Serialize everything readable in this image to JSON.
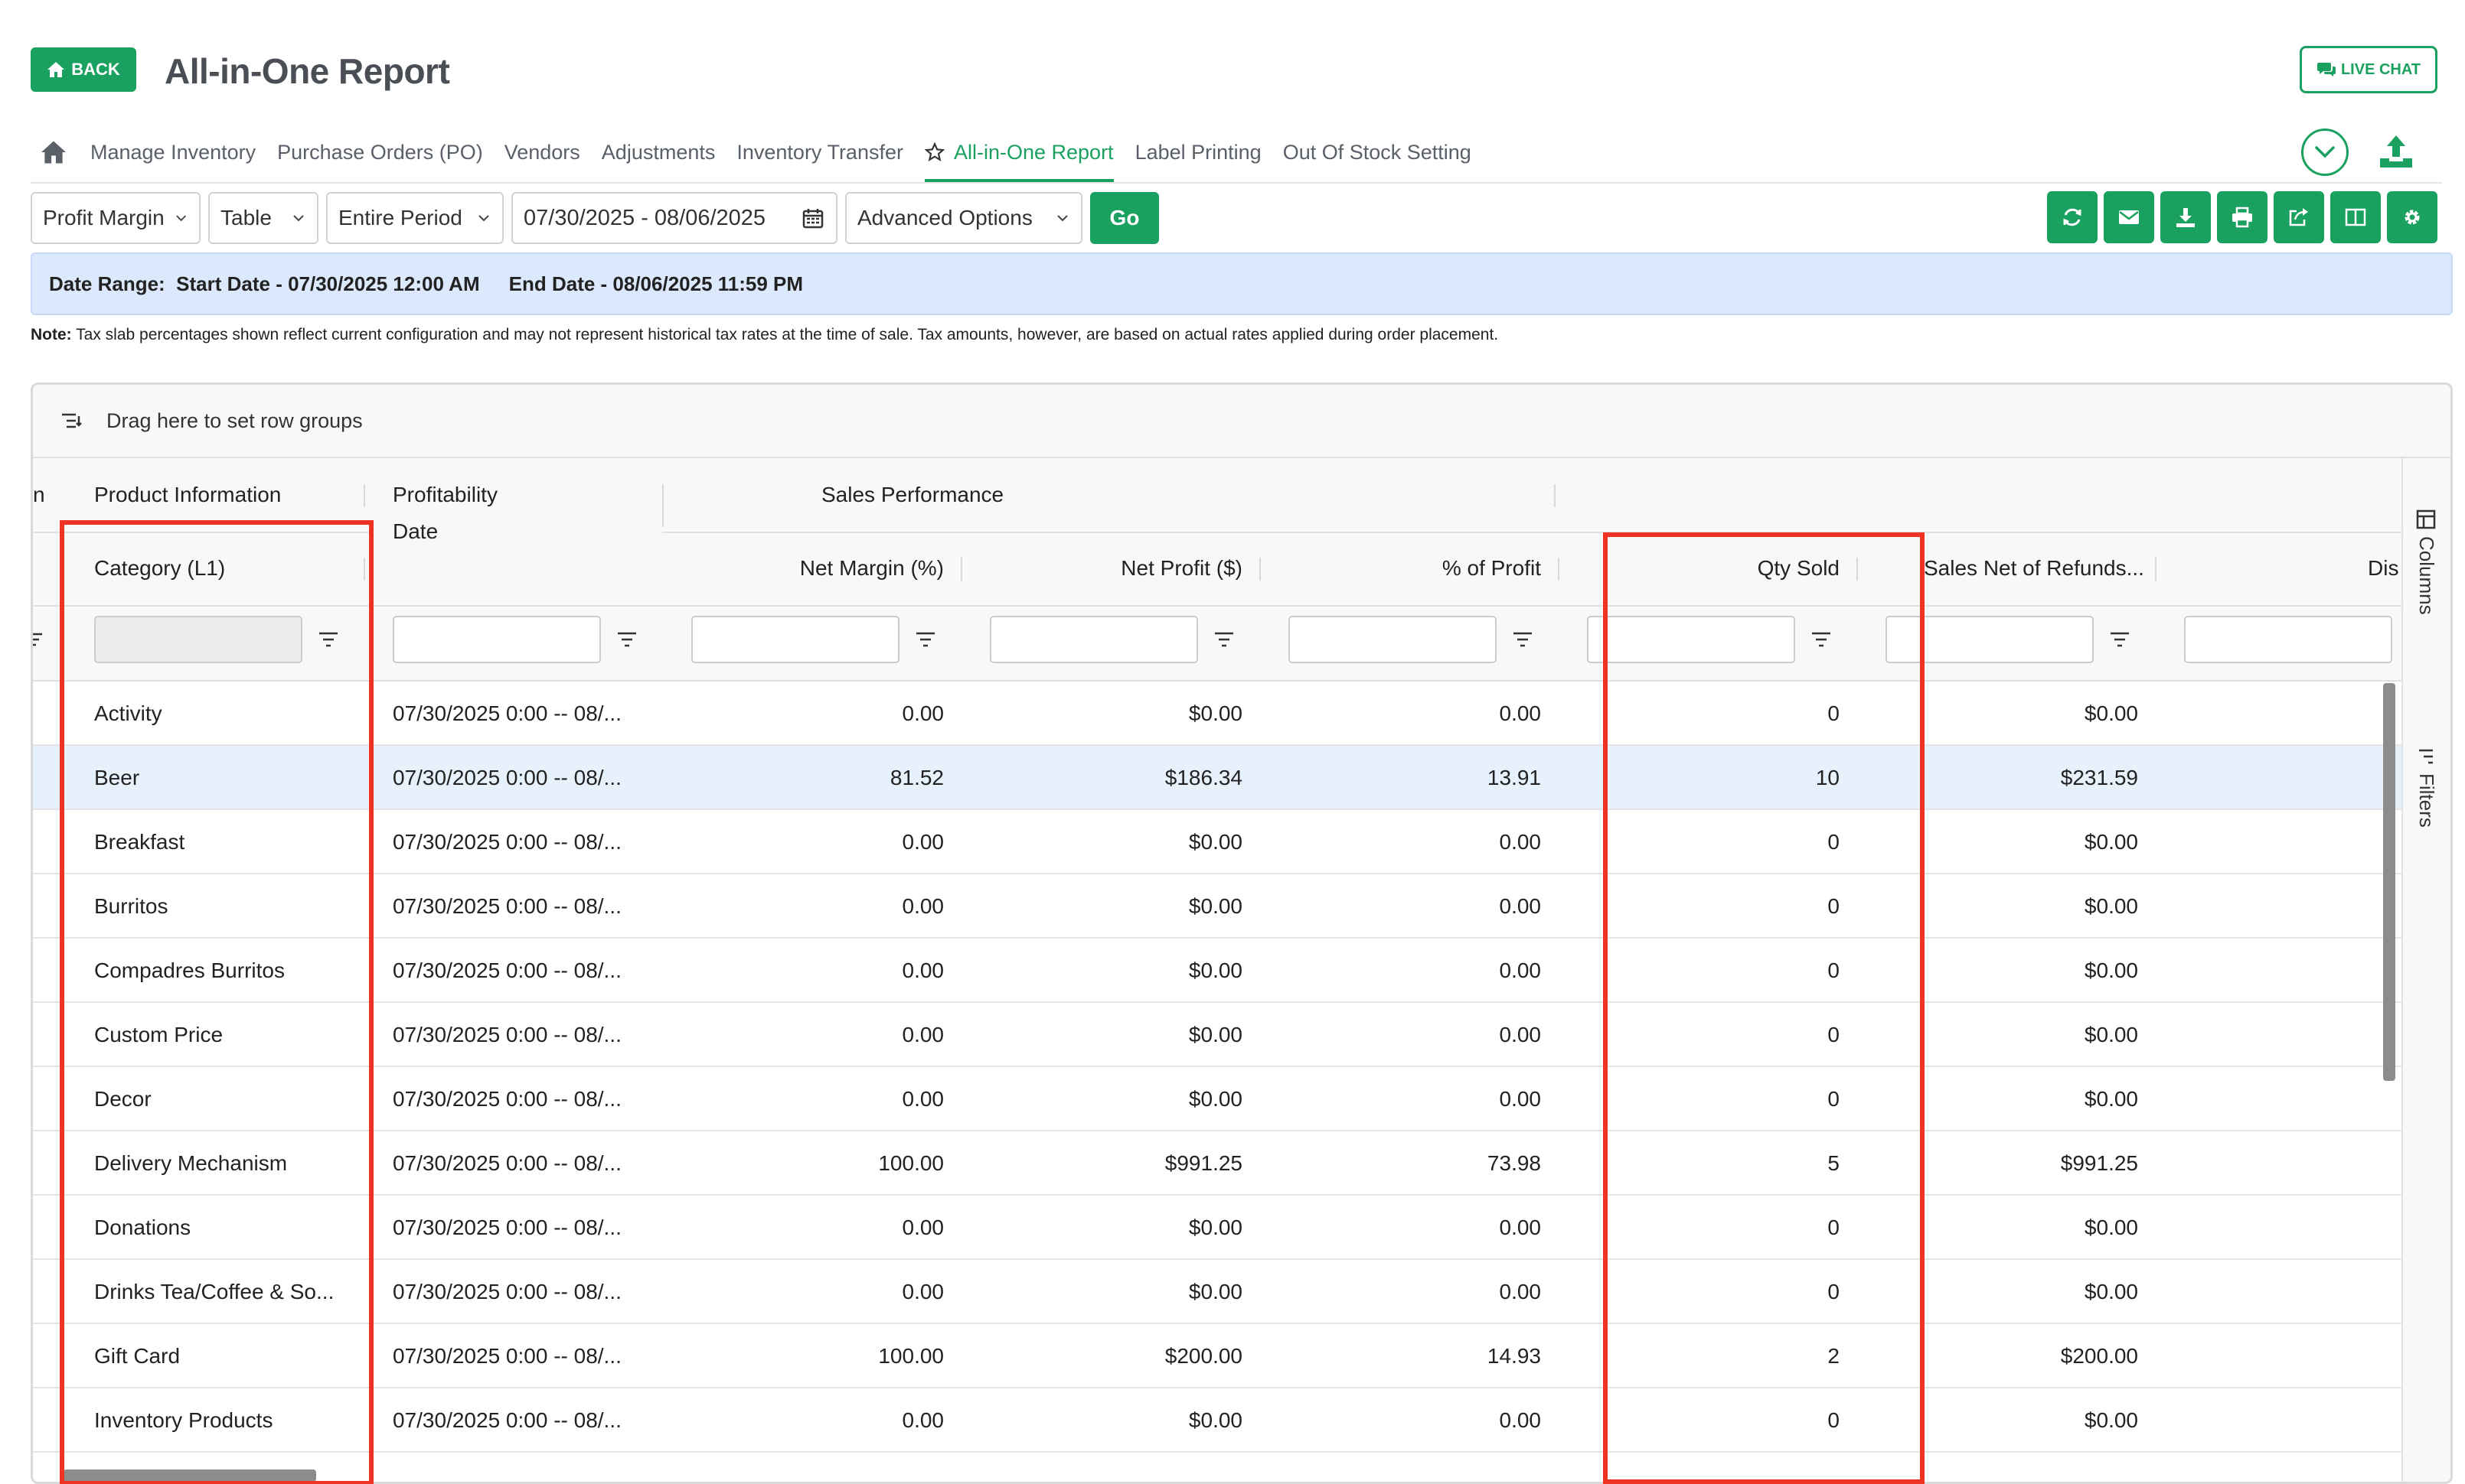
{
  "header": {
    "back_label": "BACK",
    "title": "All-in-One Report",
    "live_chat_label": "LIVE CHAT"
  },
  "nav": {
    "items": [
      {
        "label": "Manage Inventory"
      },
      {
        "label": "Purchase Orders (PO)"
      },
      {
        "label": "Vendors"
      },
      {
        "label": "Adjustments"
      },
      {
        "label": "Inventory Transfer"
      },
      {
        "label": "All-in-One Report",
        "active": true
      },
      {
        "label": "Label Printing"
      },
      {
        "label": "Out Of Stock Setting"
      }
    ]
  },
  "toolbar": {
    "report_type": "Profit Margin",
    "view_type": "Table",
    "period": "Entire Period",
    "date_range": "07/30/2025 - 08/06/2025",
    "advanced": "Advanced Options",
    "go_label": "Go",
    "tools": [
      "refresh-icon",
      "email-icon",
      "download-icon",
      "print-icon",
      "share-icon",
      "columns-icon",
      "settings-icon"
    ]
  },
  "range": {
    "label": "Date Range:",
    "start": "Start Date - 07/30/2025 12:00 AM",
    "end": "End Date - 08/06/2025 11:59 PM"
  },
  "note": {
    "label": "Note:",
    "text": "Tax slab percentages shown reflect current configuration and may not represent historical tax rates at the time of sale. Tax amounts, however, are based on actual rates applied during order placement."
  },
  "grid": {
    "group_bar": "Drag here to set row groups",
    "group_headers": {
      "cut": "n",
      "product": "Product Information",
      "profitability": "Profitability",
      "sales": "Sales Performance"
    },
    "columns": {
      "category": "Category (L1)",
      "date": "Date",
      "net_margin": "Net Margin (%)",
      "net_profit": "Net Profit ($)",
      "pct_profit": "% of Profit",
      "qty_sold": "Qty Sold",
      "sales_net": "Sales Net of Refunds...",
      "dis": "Dis"
    },
    "side": {
      "columns_label": "Columns",
      "filters_label": "Filters"
    },
    "rows": [
      {
        "category": "Activity",
        "date": "07/30/2025 0:00 -- 08/...",
        "net_margin": "0.00",
        "net_profit": "$0.00",
        "pct_profit": "0.00",
        "qty": "0",
        "sales": "$0.00"
      },
      {
        "category": "Beer",
        "date": "07/30/2025 0:00 -- 08/...",
        "net_margin": "81.52",
        "net_profit": "$186.34",
        "pct_profit": "13.91",
        "qty": "10",
        "sales": "$231.59"
      },
      {
        "category": "Breakfast",
        "date": "07/30/2025 0:00 -- 08/...",
        "net_margin": "0.00",
        "net_profit": "$0.00",
        "pct_profit": "0.00",
        "qty": "0",
        "sales": "$0.00"
      },
      {
        "category": "Burritos",
        "date": "07/30/2025 0:00 -- 08/...",
        "net_margin": "0.00",
        "net_profit": "$0.00",
        "pct_profit": "0.00",
        "qty": "0",
        "sales": "$0.00"
      },
      {
        "category": "Compadres Burritos",
        "date": "07/30/2025 0:00 -- 08/...",
        "net_margin": "0.00",
        "net_profit": "$0.00",
        "pct_profit": "0.00",
        "qty": "0",
        "sales": "$0.00"
      },
      {
        "category": "Custom Price",
        "date": "07/30/2025 0:00 -- 08/...",
        "net_margin": "0.00",
        "net_profit": "$0.00",
        "pct_profit": "0.00",
        "qty": "0",
        "sales": "$0.00"
      },
      {
        "category": "Decor",
        "date": "07/30/2025 0:00 -- 08/...",
        "net_margin": "0.00",
        "net_profit": "$0.00",
        "pct_profit": "0.00",
        "qty": "0",
        "sales": "$0.00"
      },
      {
        "category": "Delivery Mechanism",
        "date": "07/30/2025 0:00 -- 08/...",
        "net_margin": "100.00",
        "net_profit": "$991.25",
        "pct_profit": "73.98",
        "qty": "5",
        "sales": "$991.25"
      },
      {
        "category": "Donations",
        "date": "07/30/2025 0:00 -- 08/...",
        "net_margin": "0.00",
        "net_profit": "$0.00",
        "pct_profit": "0.00",
        "qty": "0",
        "sales": "$0.00"
      },
      {
        "category": "Drinks Tea/Coffee & So...",
        "date": "07/30/2025 0:00 -- 08/...",
        "net_margin": "0.00",
        "net_profit": "$0.00",
        "pct_profit": "0.00",
        "qty": "0",
        "sales": "$0.00"
      },
      {
        "category": "Gift Card",
        "date": "07/30/2025 0:00 -- 08/...",
        "net_margin": "100.00",
        "net_profit": "$200.00",
        "pct_profit": "14.93",
        "qty": "2",
        "sales": "$200.00"
      },
      {
        "category": "Inventory Products",
        "date": "07/30/2025 0:00 -- 08/...",
        "net_margin": "0.00",
        "net_profit": "$0.00",
        "pct_profit": "0.00",
        "qty": "0",
        "sales": "$0.00"
      }
    ],
    "selected_row": 1
  },
  "colors": {
    "accent": "#1aa15f",
    "highlight": "#ee3322",
    "range_bg": "#dce9fd"
  }
}
